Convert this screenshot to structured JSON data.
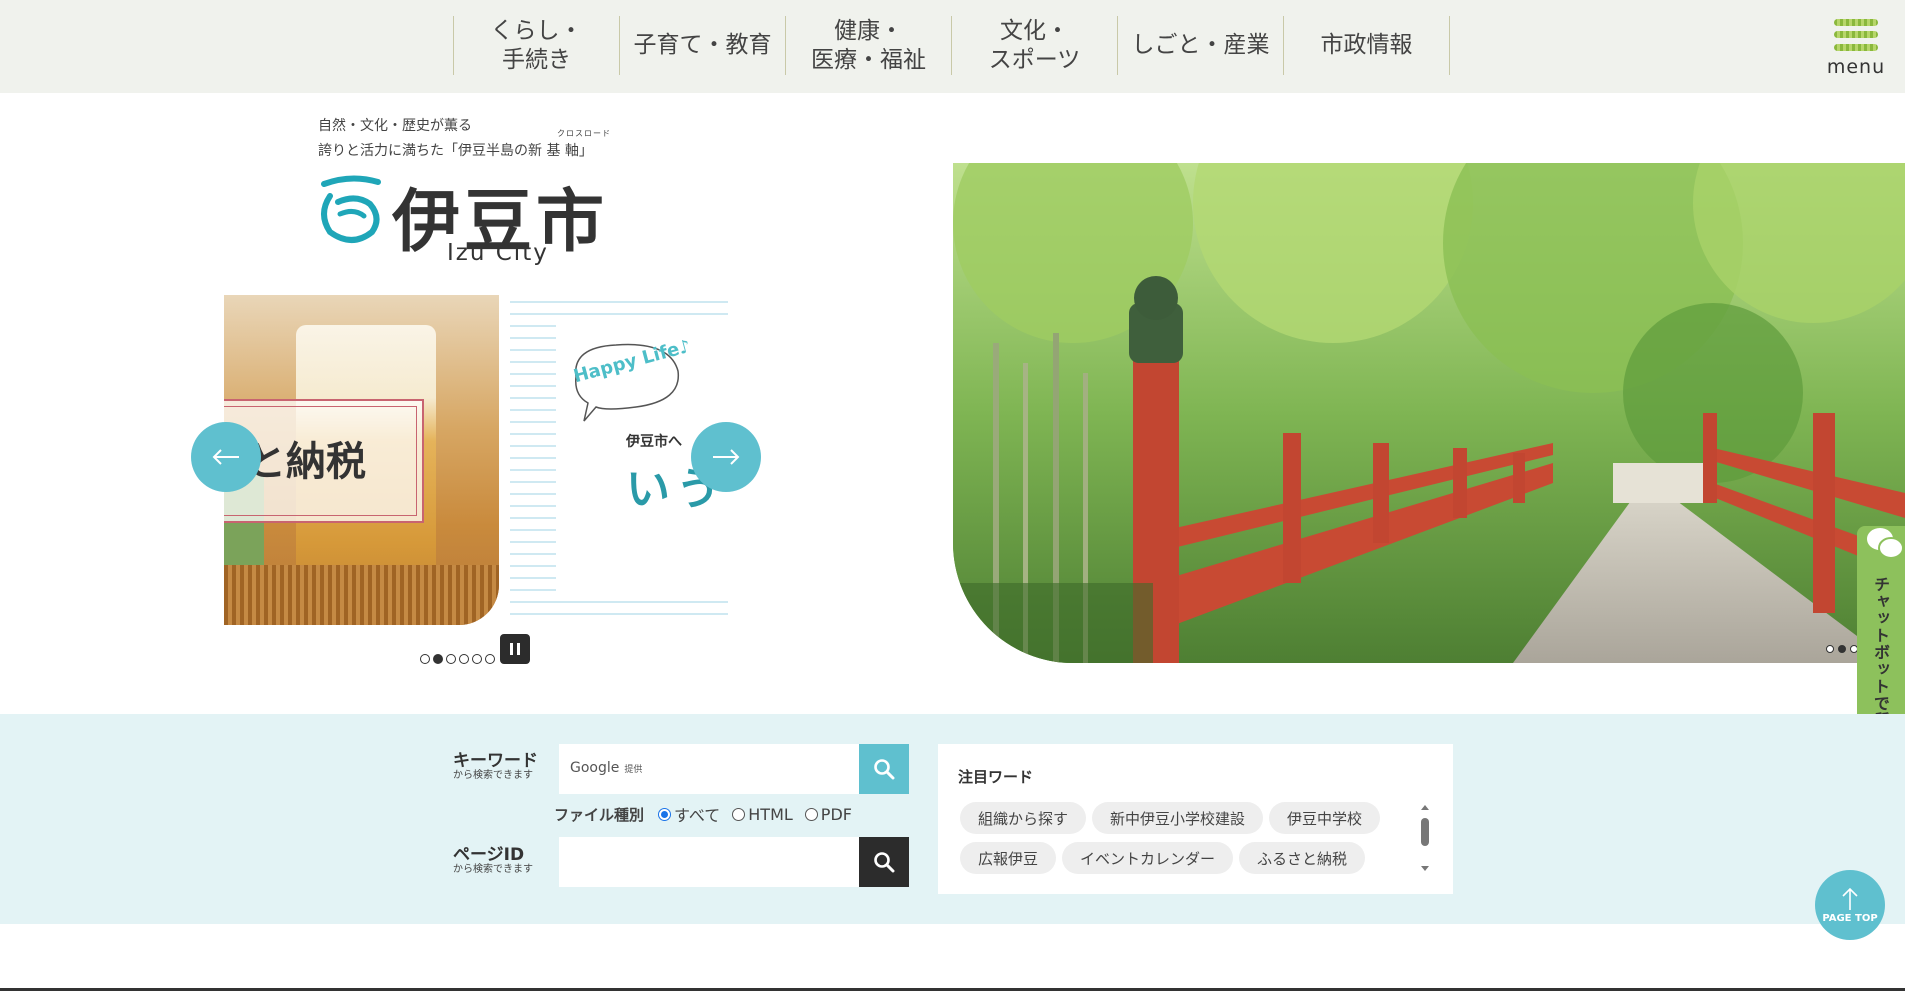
{
  "header": {
    "nav": [
      {
        "label": "くらし・\n手続き"
      },
      {
        "label": "子育て・教育"
      },
      {
        "label": "健康・\n医療・福祉"
      },
      {
        "label": "文化・\nスポーツ"
      },
      {
        "label": "しごと・産業"
      },
      {
        "label": "市政情報"
      }
    ],
    "menu_label": "menu",
    "menu_icon": "hamburger-menu-icon"
  },
  "brand": {
    "tagline_line1": "自然・文化・歴史が薫る",
    "tagline_line2": "誇りと活力に満ちた「伊豆半島の新 基 軸」",
    "tagline_ruby": "クロスロード",
    "logo_kanji": "伊豆市",
    "logo_en": "Izu City",
    "logo_color": "#1fa6b8"
  },
  "slider": {
    "slide1_text": "と納税",
    "slide2_badge": "Happy Life♪",
    "slide2_sub": "伊豆市へ",
    "slide2_big": "いう",
    "dot_count": 6,
    "active_dot": 2,
    "prev_icon": "arrow-left-icon",
    "next_icon": "arrow-right-icon",
    "pause_icon": "pause-icon"
  },
  "hero": {
    "dot_count": 3,
    "active_dot": 2
  },
  "chatbot": {
    "label": "チャットボットで質問する",
    "icon": "chat-bubble-icon"
  },
  "search": {
    "keyword_label": "キーワード",
    "keyword_sub": "から検索できます",
    "google_label": "Google",
    "google_sub": "提供",
    "file_type_label": "ファイル種別",
    "file_types": [
      "すべて",
      "HTML",
      "PDF"
    ],
    "selected_file_type": "すべて",
    "pageid_label": "ページID",
    "pageid_sub": "から検索できます",
    "search_icon": "search-icon"
  },
  "attention": {
    "title": "注目ワード",
    "words": [
      "組織から探す",
      "新中伊豆小学校建設",
      "伊豆中学校",
      "広報伊豆",
      "イベントカレンダー",
      "ふるさと納税"
    ]
  },
  "pagetop": {
    "label": "PAGE TOP",
    "icon": "arrow-up-icon"
  },
  "colors": {
    "accent": "#5fc0cf",
    "header_bg": "#f0f2ed",
    "search_bg": "#e3f3f5",
    "chatbot": "#8dc15c"
  }
}
